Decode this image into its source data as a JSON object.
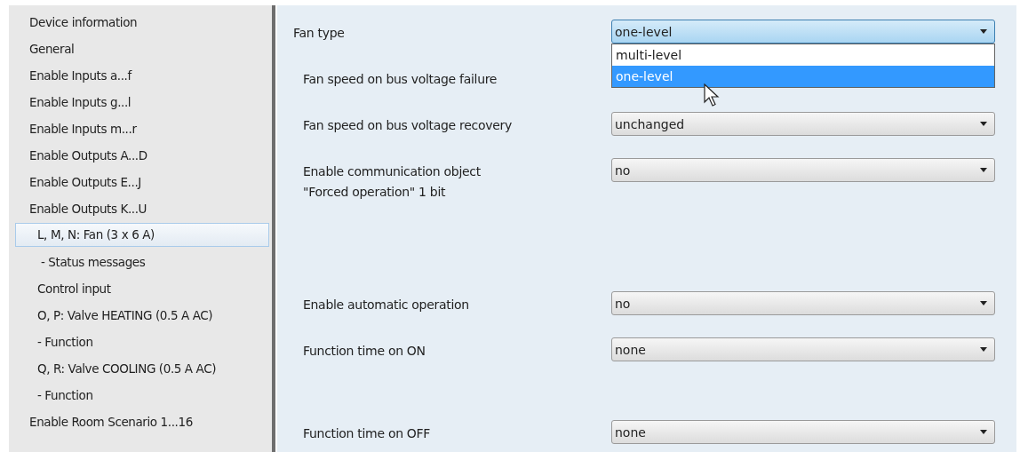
{
  "sidebar": {
    "items": [
      {
        "label": "Device information",
        "selected": false
      },
      {
        "label": "General",
        "selected": false
      },
      {
        "label": "Enable Inputs a...f",
        "selected": false
      },
      {
        "label": "Enable Inputs g...l",
        "selected": false
      },
      {
        "label": "Enable Inputs m...r",
        "selected": false
      },
      {
        "label": "Enable Outputs A...D",
        "selected": false
      },
      {
        "label": "Enable Outputs E...J",
        "selected": false
      },
      {
        "label": "Enable Outputs K...U",
        "selected": false,
        "children": [
          {
            "label": "L, M, N: Fan (3 x 6 A)",
            "selected": true,
            "children": [
              {
                "label": "- Status messages",
                "selected": false
              }
            ]
          },
          {
            "label": "Control input",
            "selected": false
          },
          {
            "label": "O, P: Valve HEATING (0.5 A AC)",
            "selected": false
          },
          {
            "label": "- Function",
            "selected": false
          },
          {
            "label": "Q, R: Valve COOLING (0.5 A AC)",
            "selected": false
          },
          {
            "label": "- Function",
            "selected": false
          }
        ]
      },
      {
        "label": "Enable Room Scenario 1...16",
        "selected": false
      }
    ]
  },
  "parameters": [
    {
      "label": "Fan type",
      "value": "one-level",
      "expanded": true,
      "options": [
        {
          "label": "multi-level",
          "selected": false
        },
        {
          "label": "one-level",
          "selected": true
        }
      ]
    },
    {
      "label": "Fan speed on bus voltage failure"
    },
    {
      "label": "Fan speed on bus voltage recovery",
      "value": "unchanged"
    },
    {
      "label": "Enable communication object\n\"Forced operation\" 1 bit",
      "value": "no"
    },
    {
      "label": "Enable automatic operation",
      "value": "no"
    },
    {
      "label": "Function time on ON",
      "value": "none"
    },
    {
      "label": "Function time on OFF",
      "value": "none"
    }
  ]
}
